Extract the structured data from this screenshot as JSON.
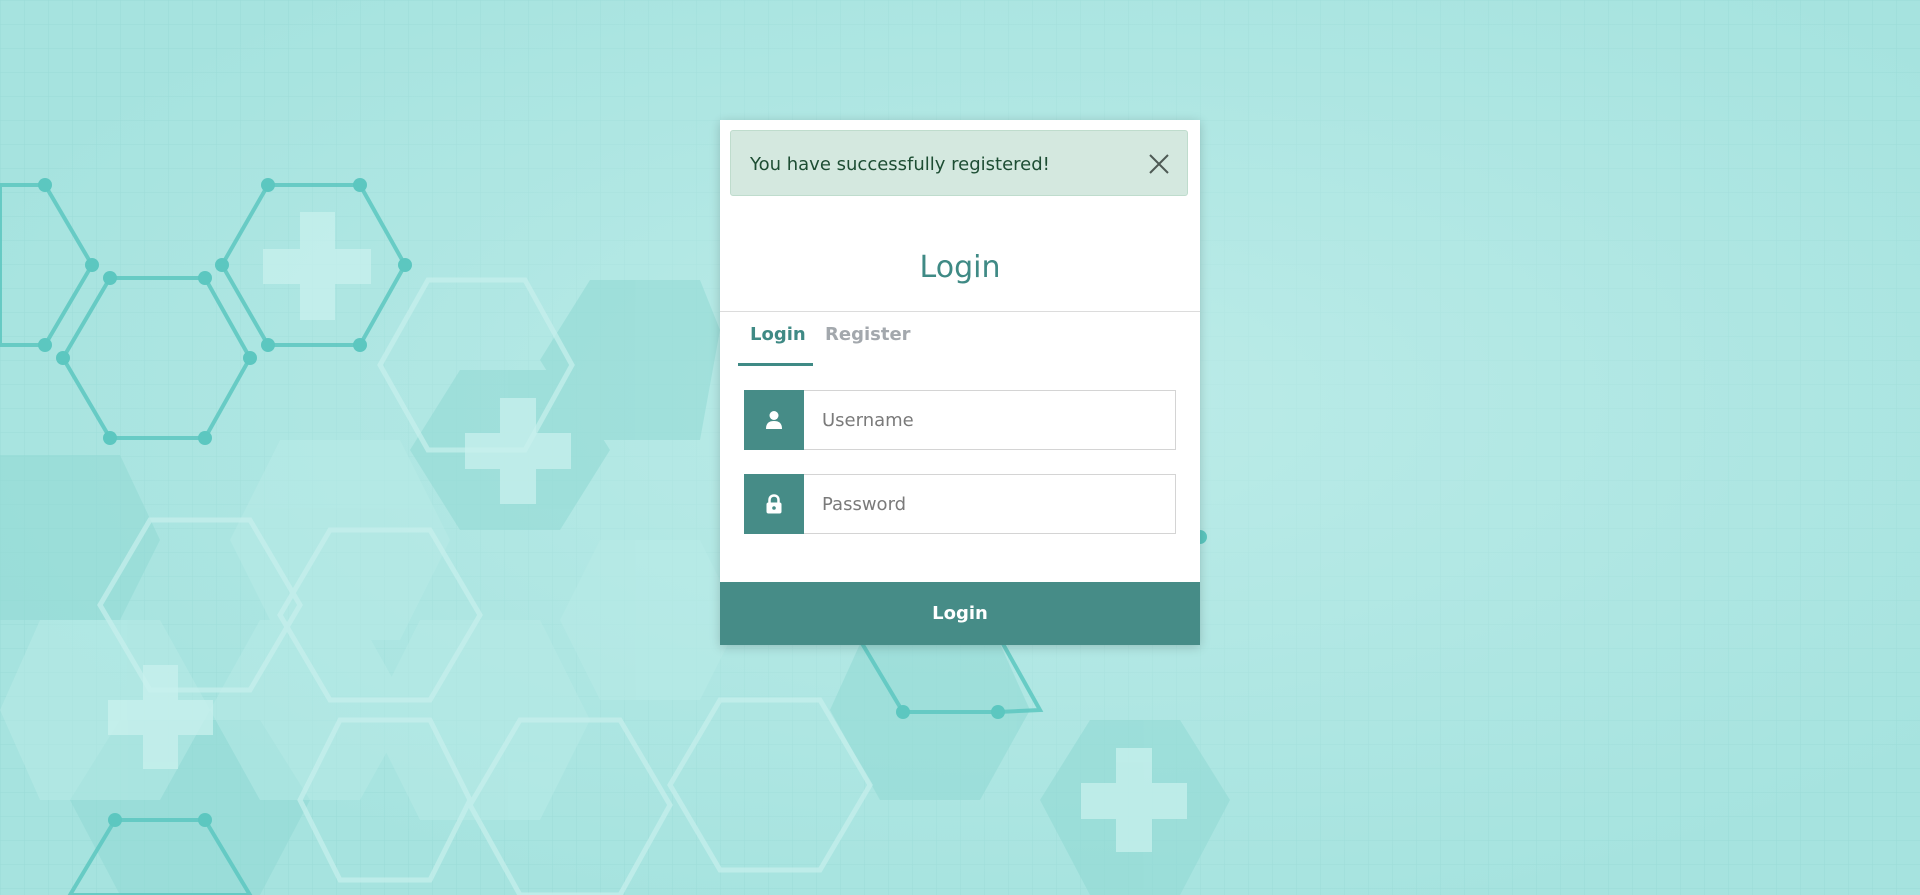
{
  "alert": {
    "message": "You have successfully registered!",
    "close_icon": "close-icon"
  },
  "card": {
    "title": "Login"
  },
  "tabs": [
    {
      "label": "Login",
      "active": true
    },
    {
      "label": "Register",
      "active": false
    }
  ],
  "form": {
    "username": {
      "placeholder": "Username",
      "value": "",
      "icon": "user-icon"
    },
    "password": {
      "placeholder": "Password",
      "value": "",
      "icon": "lock-icon"
    },
    "submit_label": "Login"
  },
  "colors": {
    "accent": "#468c87",
    "title": "#3f8a85",
    "alert_bg": "#d4e8df",
    "alert_text": "#1d4d33",
    "inactive_tab": "#a3a8ad",
    "background": "#a6e3df"
  }
}
